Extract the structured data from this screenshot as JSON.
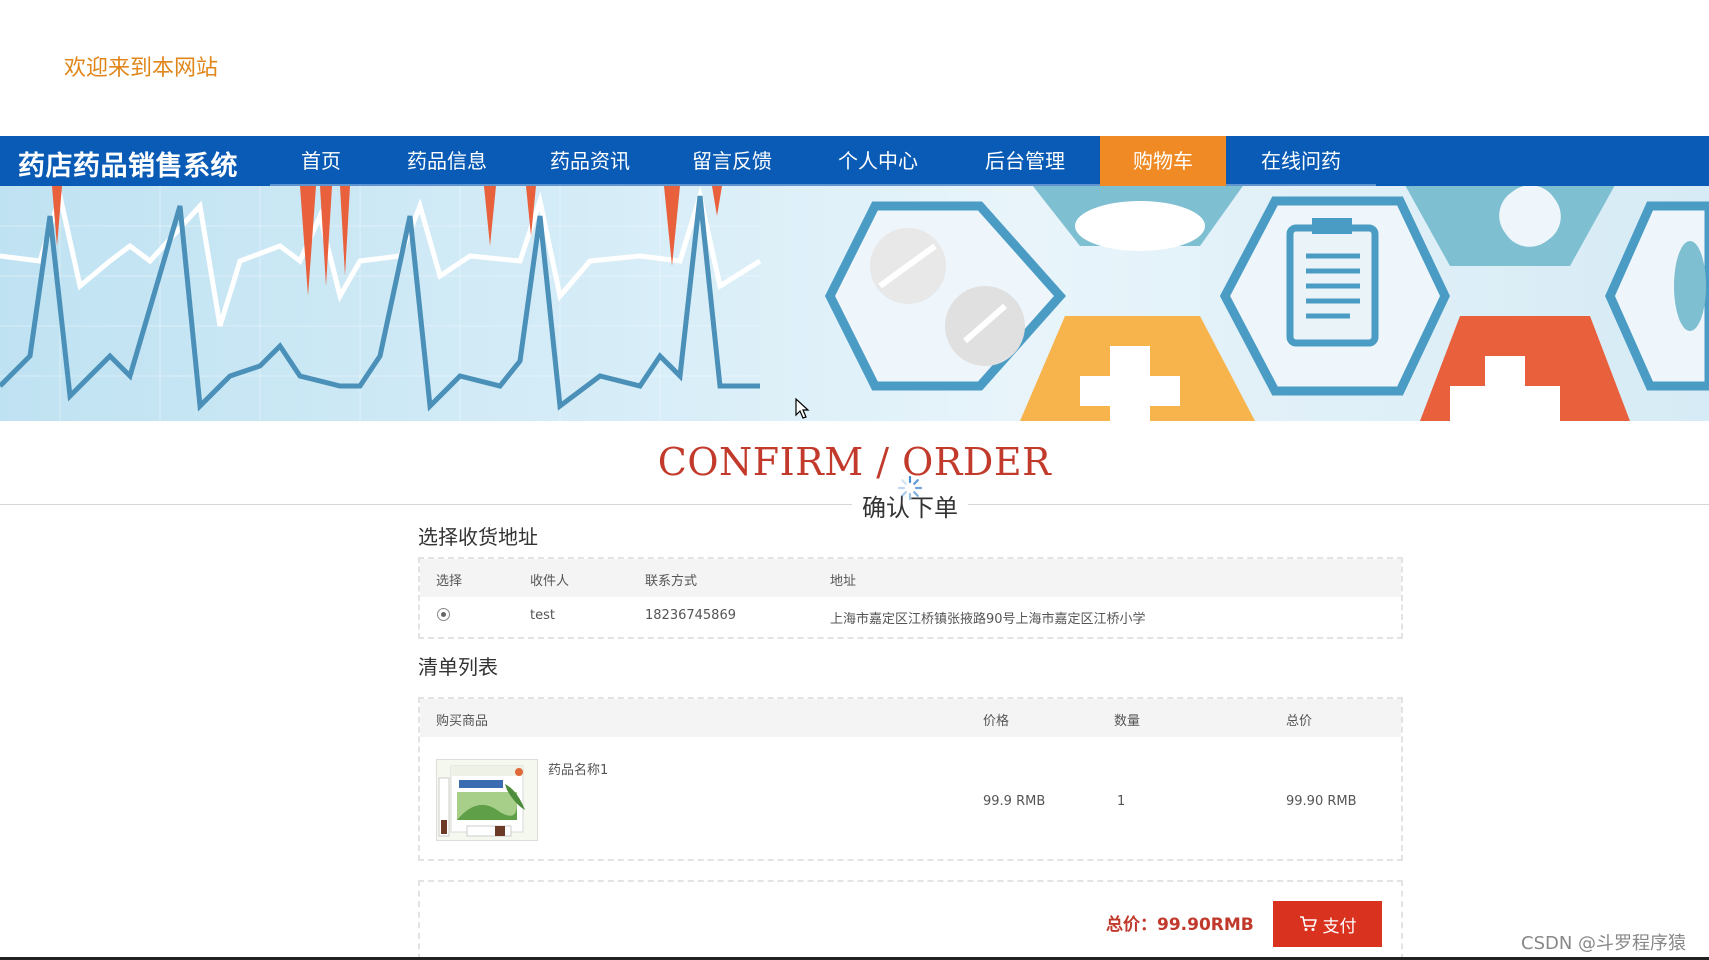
{
  "header": {
    "welcome": "欢迎来到本网站"
  },
  "nav": {
    "site_title": "药店药品销售系统",
    "items": [
      {
        "label": "首页"
      },
      {
        "label": "药品信息"
      },
      {
        "label": "药品资讯"
      },
      {
        "label": "留言反馈"
      },
      {
        "label": "个人中心"
      },
      {
        "label": "后台管理"
      },
      {
        "label": "购物车"
      },
      {
        "label": "在线问药"
      }
    ],
    "active_item": "购物车"
  },
  "page": {
    "title_en": "CONFIRM / ORDER",
    "title_cn": "确认下单"
  },
  "address": {
    "section_title": "选择收货地址",
    "columns": [
      "选择",
      "收件人",
      "联系方式",
      "地址"
    ],
    "rows": [
      {
        "selected": true,
        "recipient": "test",
        "phone": "18236745869",
        "address": "上海市嘉定区江桥镇张掖路90号上海市嘉定区江桥小学"
      }
    ]
  },
  "order": {
    "section_title": "清单列表",
    "columns": [
      "购买商品",
      "价格",
      "数量",
      "总价"
    ],
    "items": [
      {
        "name": "药品名称1",
        "price": "99.9 RMB",
        "quantity": "1",
        "total": "99.90 RMB"
      }
    ]
  },
  "summary": {
    "total_label": "总价：99.90RMB",
    "pay_label": "支付"
  },
  "watermark": "CSDN @斗罗程序猿",
  "colors": {
    "nav_bg": "#0a5bb5",
    "nav_active": "#f08a24",
    "accent_red": "#c23a2b",
    "pay_button": "#d9321f",
    "welcome": "#e0861a"
  }
}
